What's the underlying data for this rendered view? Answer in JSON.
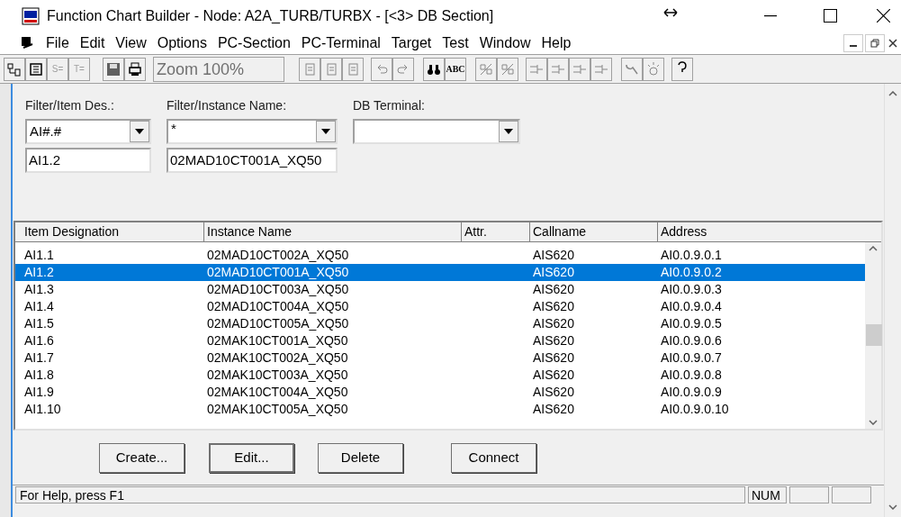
{
  "window": {
    "title": "Function Chart Builder - Node: A2A_TURB/TURBX - [<3> DB Section]"
  },
  "menu": [
    "File",
    "Edit",
    "View",
    "Options",
    "PC-Section",
    "PC-Terminal",
    "Target",
    "Test",
    "Window",
    "Help"
  ],
  "toolbar": {
    "text_buttons": [
      {
        "label": "S=",
        "disabled": true
      },
      {
        "label": "T=",
        "disabled": true
      }
    ],
    "zoom": "Zoom 100%",
    "spell_button": "ABC"
  },
  "filters": [
    {
      "label": "Filter/Item Des.:",
      "value": "AI#.#",
      "field": "AI1.2"
    },
    {
      "label": "Filter/Instance Name:",
      "value": "*",
      "field": "02MAD10CT001A_XQ50"
    },
    {
      "label": "DB Terminal:"
    }
  ],
  "table": {
    "columns": [
      "Item Designation",
      "Instance Name",
      "Attr.",
      "Callname",
      "Address"
    ],
    "rows": [
      {
        "cells": [
          "AI1.1",
          "02MAD10CT002A_XQ50",
          "",
          "AIS620",
          "AI0.0.9.0.1"
        ],
        "selected": false
      },
      {
        "cells": [
          "AI1.2",
          "02MAD10CT001A_XQ50",
          "",
          "AIS620",
          "AI0.0.9.0.2"
        ],
        "selected": true
      },
      {
        "cells": [
          "AI1.3",
          "02MAD10CT003A_XQ50",
          "",
          "AIS620",
          "AI0.0.9.0.3"
        ],
        "selected": false
      },
      {
        "cells": [
          "AI1.4",
          "02MAD10CT004A_XQ50",
          "",
          "AIS620",
          "AI0.0.9.0.4"
        ],
        "selected": false
      },
      {
        "cells": [
          "AI1.5",
          "02MAD10CT005A_XQ50",
          "",
          "AIS620",
          "AI0.0.9.0.5"
        ],
        "selected": false
      },
      {
        "cells": [
          "AI1.6",
          "02MAK10CT001A_XQ50",
          "",
          "AIS620",
          "AI0.0.9.0.6"
        ],
        "selected": false
      },
      {
        "cells": [
          "AI1.7",
          "02MAK10CT002A_XQ50",
          "",
          "AIS620",
          "AI0.0.9.0.7"
        ],
        "selected": false
      },
      {
        "cells": [
          "AI1.8",
          "02MAK10CT003A_XQ50",
          "",
          "AIS620",
          "AI0.0.9.0.8"
        ],
        "selected": false
      },
      {
        "cells": [
          "AI1.9",
          "02MAK10CT004A_XQ50",
          "",
          "AIS620",
          "AI0.0.9.0.9"
        ],
        "selected": false
      },
      {
        "cells": [
          "AI1.10",
          "02MAK10CT005A_XQ50",
          "",
          "AIS620",
          "AI0.0.9.0.10"
        ],
        "selected": false
      }
    ]
  },
  "buttons": [
    "Create...",
    "Edit...",
    "Delete",
    "Connect"
  ],
  "status_bar": {
    "message": "For Help, press F1",
    "indicator": "NUM"
  }
}
